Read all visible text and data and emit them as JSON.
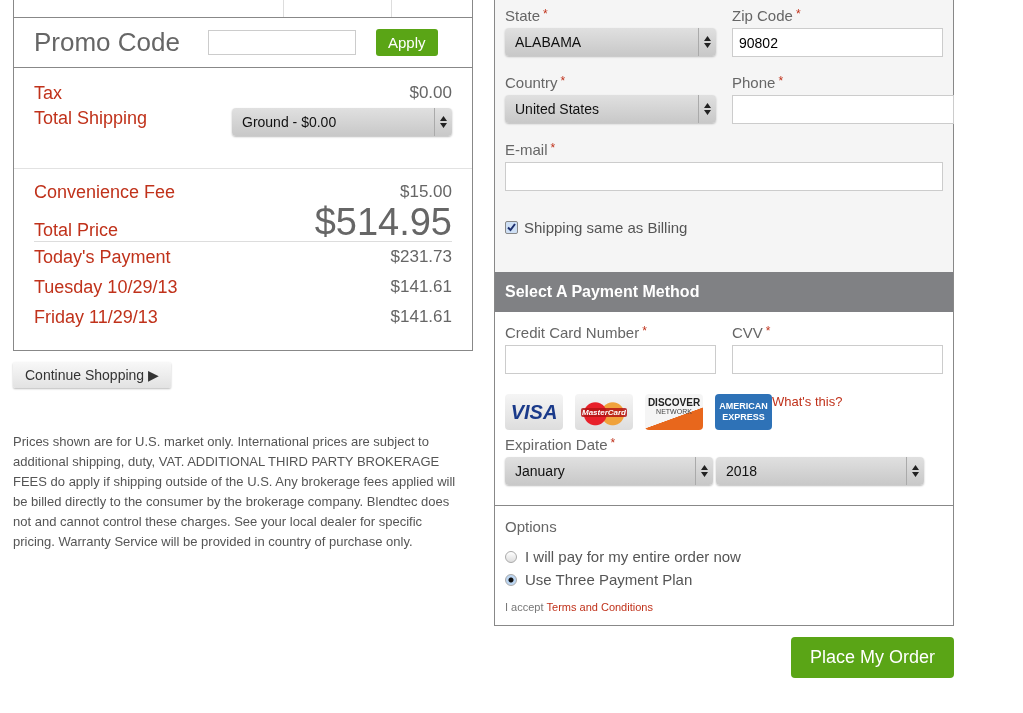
{
  "promo": {
    "label": "Promo Code",
    "button": "Apply"
  },
  "charges": [
    {
      "label": "Tax",
      "amount": "$0.00"
    }
  ],
  "shipping": {
    "label": "Total Shipping",
    "value": "Ground - $0.00"
  },
  "fees": [
    {
      "label": "Convenience Fee",
      "amount": "$15.00",
      "kind": "normal"
    },
    {
      "label": "Total Price",
      "amount": "$514.95",
      "kind": "total"
    },
    {
      "label": "Today's Payment",
      "amount": "$231.73",
      "kind": "normal"
    },
    {
      "label": "Tuesday 10/29/13",
      "amount": "$141.61",
      "kind": "normal"
    },
    {
      "label": "Friday 11/29/13",
      "amount": "$141.61",
      "kind": "normal"
    }
  ],
  "continue_button": "Continue Shopping ▶",
  "disclaimer": "Prices shown are for U.S. market only. International prices are subject to additional shipping, duty, VAT. ADDITIONAL THIRD PARTY BROKERAGE FEES do apply if shipping outside of the U.S. Any brokerage fees applied will be billed directly to the consumer by the brokerage company. Blendtec does not and cannot control these charges. See your local dealer for specific pricing. Warranty Service will be provided in country of purchase only.",
  "billing": {
    "fields": [
      {
        "label": "State",
        "required": "*",
        "kind": "select",
        "value": "ALABAMA"
      },
      {
        "label": "Zip Code",
        "required": "*",
        "kind": "input",
        "value": "90802"
      },
      {
        "label": "Country",
        "required": "*",
        "kind": "select",
        "value": "United States"
      },
      {
        "label": "Phone",
        "required": "*",
        "kind": "input"
      },
      {
        "label": "E-mail",
        "required": "*",
        "kind": "wide"
      }
    ],
    "same_as_billing": {
      "label": "Shipping same as Billing",
      "checked": true
    }
  },
  "payment": {
    "title": "Select A Payment Method",
    "fields": [
      {
        "label": "Credit Card Number",
        "required": "*"
      },
      {
        "label": "CVV",
        "required": "*"
      }
    ],
    "cards": [
      {
        "kind": "visa",
        "label": "VISA"
      },
      {
        "kind": "mastercard",
        "label": "MasterCard"
      },
      {
        "kind": "discover",
        "label": "DISCOVER",
        "sub": "NETWORK"
      },
      {
        "kind": "amex",
        "label": "AMERICAN",
        "sub": "EXPRESS"
      }
    ],
    "whats_this": "What's this?",
    "expiration": {
      "label": "Expiration Date",
      "required": "*",
      "month": "January",
      "year": "2018"
    }
  },
  "options": {
    "title": "Options",
    "choices": [
      {
        "label": "I will pay for my entire order now",
        "selected": false
      },
      {
        "label": "Use Three Payment Plan",
        "selected": true
      }
    ],
    "accept": "I accept",
    "terms": "Terms and Conditions"
  },
  "place_order": "Place My Order"
}
